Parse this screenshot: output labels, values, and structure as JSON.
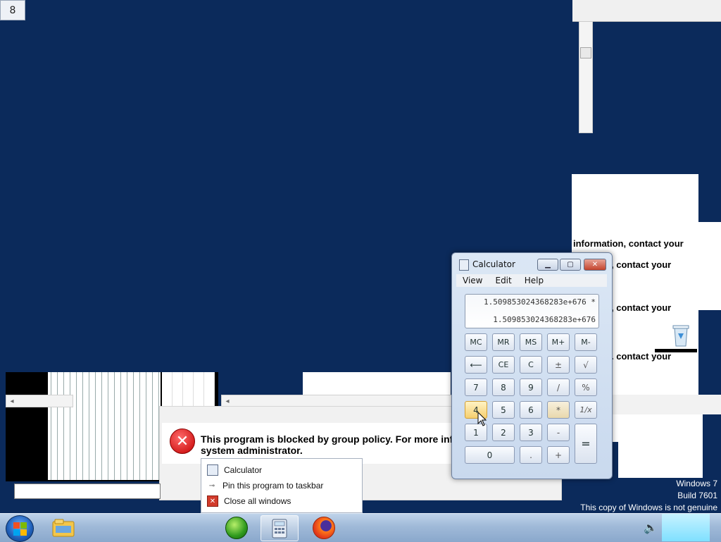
{
  "corner_indicator": "8",
  "error": {
    "message_line1": "This program is blocked by group policy. For more infor",
    "message_line2": "system administrator."
  },
  "right_fragments": [
    "information, contact your",
    ", contact your",
    ", contact your",
    ". contact your"
  ],
  "calculator": {
    "title": "Calculator",
    "menu": [
      "View",
      "Edit",
      "Help"
    ],
    "expression": "1.509853024368283e+676 *",
    "result": "1.509853024368283e+676",
    "memory_keys": [
      "MC",
      "MR",
      "MS",
      "M+",
      "M-"
    ],
    "row2": [
      "⟵",
      "CE",
      "C",
      "±",
      "√"
    ],
    "row3": [
      "7",
      "8",
      "9",
      "/",
      "%"
    ],
    "row4": [
      "4",
      "5",
      "6",
      "*",
      "1/x"
    ],
    "row5": [
      "1",
      "2",
      "3",
      "-"
    ],
    "row6": [
      "0",
      ".",
      "+"
    ],
    "equals": "="
  },
  "jumplist": {
    "items": [
      {
        "label": "Calculator",
        "icon": "calculator-icon"
      },
      {
        "label": "Pin this program to taskbar",
        "icon": "pin-icon"
      },
      {
        "label": "Close all windows",
        "icon": "close-window-icon"
      }
    ]
  },
  "watermark": {
    "line1": "Windows 7",
    "line2": "Build 7601",
    "line3": "This copy of Windows is not genuine"
  },
  "taskbar": {
    "pinned": [
      "start-orb",
      "explorer-icon",
      "media-center-icon",
      "calculator-icon",
      "firefox-icon"
    ],
    "tray": [
      "speaker-icon"
    ]
  },
  "colors": {
    "desktop": "#0b2a5b",
    "taskbar": "#9fb9d8",
    "error_red": "#c40000",
    "hot_key": "#f6cf6f"
  }
}
